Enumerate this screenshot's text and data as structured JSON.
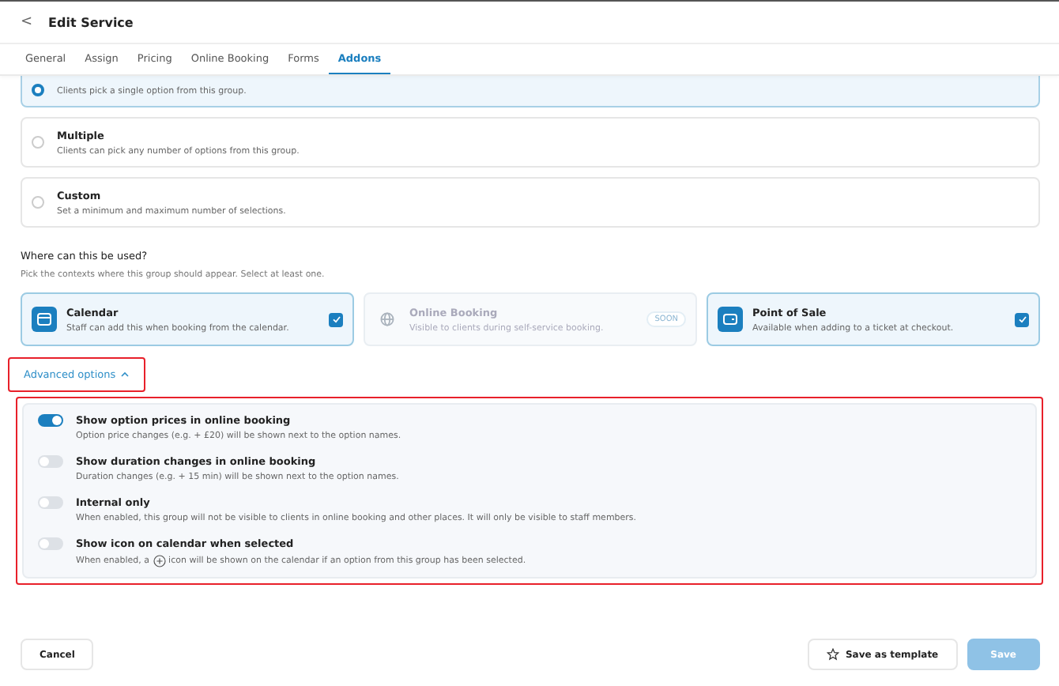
{
  "header": {
    "back": "<",
    "title": "Edit Service"
  },
  "tabs": [
    {
      "label": "General",
      "selected": false
    },
    {
      "label": "Assign",
      "selected": false
    },
    {
      "label": "Pricing",
      "selected": false
    },
    {
      "label": "Online Booking",
      "selected": false
    },
    {
      "label": "Forms",
      "selected": false
    },
    {
      "label": "Addons",
      "selected": true
    }
  ],
  "selection_types": [
    {
      "description": "Clients pick a single option from this group.",
      "selected": true
    },
    {
      "title": "Multiple",
      "description": "Clients can pick any number of options from this group.",
      "selected": false
    },
    {
      "title": "Custom",
      "description": "Set a minimum and maximum number of selections.",
      "selected": false
    }
  ],
  "usage": {
    "heading": "Where can this be used?",
    "hint": "Pick the contexts where this group should appear. Select at least one.",
    "contexts": [
      {
        "kind": "calendar",
        "title": "Calendar",
        "description": "Staff can add this when booking from the calendar.",
        "checked": true,
        "disabled": false
      },
      {
        "kind": "globe",
        "title": "Online Booking",
        "description": "Visible to clients during self-service booking.",
        "badge": "SOON",
        "checked": false,
        "disabled": true
      },
      {
        "kind": "wallet",
        "title": "Point of Sale",
        "description": "Available when adding to a ticket at checkout.",
        "checked": true,
        "disabled": false
      }
    ]
  },
  "advanced": {
    "label": "Advanced options",
    "expanded": true,
    "highlighted": true,
    "options": [
      {
        "title": "Show option prices in online booking",
        "description": "Option price changes (e.g. + £20) will be shown next to the option names.",
        "on": true
      },
      {
        "title": "Show duration changes in online booking",
        "description": "Duration changes (e.g. + 15 min) will be shown next to the option names.",
        "on": false
      },
      {
        "title": "Internal only",
        "description": "When enabled, this group will not be visible to clients in online booking and other places. It will only be visible to staff members.",
        "on": false
      },
      {
        "title": "Show icon on calendar when selected",
        "description_before": "When enabled, a",
        "description_after": "icon will be shown on the calendar if an option from this group has been selected.",
        "on": false
      }
    ]
  },
  "footer": {
    "cancel": "Cancel",
    "template": "Save as template",
    "save": "Save",
    "save_disabled": true
  }
}
